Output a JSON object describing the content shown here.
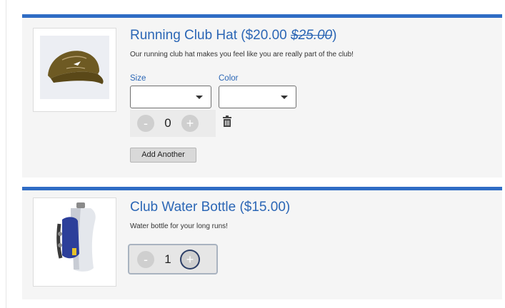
{
  "products": [
    {
      "name": "Running Club Hat",
      "price": "($20.00 ",
      "original_price": "$25.00",
      "price_close": ")",
      "description": "Our running club hat makes you feel like you are really part of the club!",
      "image": "hat-image",
      "options": [
        {
          "label": "Size",
          "value": ""
        },
        {
          "label": "Color",
          "value": ""
        }
      ],
      "quantity": "0",
      "minus_icon": "-",
      "plus_icon": "+",
      "trash_icon": "trash-icon",
      "add_another_label": "Add Another"
    },
    {
      "name": "Club Water Bottle",
      "price": "($15.00)",
      "description": "Water bottle for your long runs!",
      "image": "bottle-image",
      "quantity": "1",
      "minus_icon": "-",
      "plus_icon": "+"
    }
  ],
  "colors": {
    "accent": "#2f6cc4",
    "title": "#2b66b5",
    "card_bg": "#f5f5f5"
  }
}
